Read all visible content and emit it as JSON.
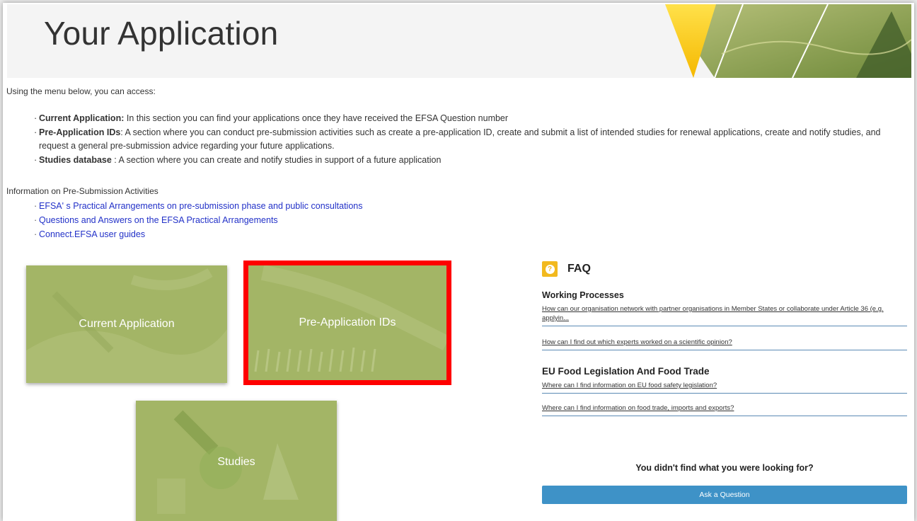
{
  "hero": {
    "title": "Your Application"
  },
  "intro": "Using the menu below, you can access:",
  "bullets": [
    {
      "key": "Current Application:",
      "text": " In this section you can find your applications once they have received the EFSA Question number"
    },
    {
      "key": "Pre-Application IDs",
      "text": ": A section where you can conduct pre-submission activities such as create a pre-application ID, create and submit a list of intended studies for renewal applications, create and notify studies, and request a general pre-submission advice regarding your future applications."
    },
    {
      "key": "Studies database",
      "text": " : A section where you can create and notify studies in support of a future application"
    }
  ],
  "info": {
    "title": "Information on Pre-Submission Activities",
    "links": [
      "EFSA' s Practical Arrangements on pre-submission phase and public consultations",
      "Questions and Answers on the EFSA Practical Arrangements",
      "Connect.EFSA user guides"
    ]
  },
  "tiles": {
    "current": "Current Application",
    "pre": "Pre-Application IDs",
    "studies": "Studies"
  },
  "faq": {
    "title": "FAQ",
    "sections": [
      {
        "name": "Working Processes",
        "questions": [
          "How can our organisation network with partner organisations in Member States or collaborate under Article 36 (e.g. applyin...",
          "How can I find out which experts worked on a scientific opinion?"
        ]
      },
      {
        "name": "EU Food Legislation And Food Trade",
        "questions": [
          "Where can I find information on EU food safety legislation?",
          "Where can I find information on food trade, imports and exports?"
        ]
      }
    ],
    "not_found": "You didn't find what you were looking for?",
    "ask_button": "Ask a Question"
  },
  "colors": {
    "tile": "#a6b86a",
    "highlight": "#ff0000",
    "accent": "#3e92c7",
    "faq_icon": "#f2b91e"
  }
}
